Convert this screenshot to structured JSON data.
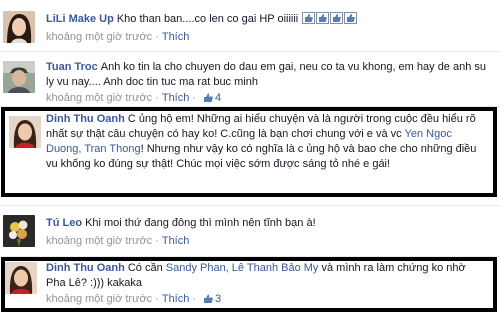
{
  "comments": [
    {
      "name": "LiLi Make Up",
      "text": "Kho than ban....co len co gai HP oiiiiii",
      "time": "khoảng một giờ trước",
      "like": "Thích",
      "likes": "",
      "emoji_count": 4,
      "avatar": "avatar-woman-dark-hair"
    },
    {
      "name": "Tuan Troc",
      "text": "Anh ko tin la cho chuyen do dau em gai, neu co ta vu khong, em hay de anh su ly vu nay.... Anh doc tin tuc ma rat buc minh",
      "time": "khoảng một giờ trước",
      "like": "Thích",
      "likes": "4",
      "avatar": "avatar-man-cap"
    },
    {
      "name": "Dinh Thu Oanh",
      "text_before": "C ủng hộ em! Những ai hiểu chuyện và là người trong cuộc đều hiểu rõ nhất sự thật câu chuyện có hay ko! C.cũng là bạn chơi chung với e và vc ",
      "tag": "Yen Ngoc Duong, Tran Thong",
      "text_after": "! Nhưng như vậy ko có nghĩa là c ủng hộ và bao che cho những điều vu khống ko đúng sự thật! Chúc mọi việc sớm được sáng tỏ nhé e gái!",
      "avatar": "avatar-woman-red"
    },
    {
      "name": "Tú Leo",
      "text": "Khi moi thứ đang đông thì mình nên tĩnh bạn à!",
      "time": "khoảng một giờ trước",
      "like": "Thích",
      "likes": "",
      "avatar": "avatar-bouquet"
    },
    {
      "name": "Dinh Thu Oanh",
      "text_before": "Có cần ",
      "tag": "Sandy Phan, Lê Thanh Bảo My",
      "text_after": " và mình ra làm chứng ko nhờ Pha Lê? :))) kakaka",
      "time": "khoảng một giờ trước",
      "like": "Thích",
      "likes": "3",
      "avatar": "avatar-woman-red"
    }
  ],
  "dot": "·",
  "colors": {
    "link": "#3b5998",
    "meta": "#90949c",
    "highlight_border": "#000000"
  }
}
